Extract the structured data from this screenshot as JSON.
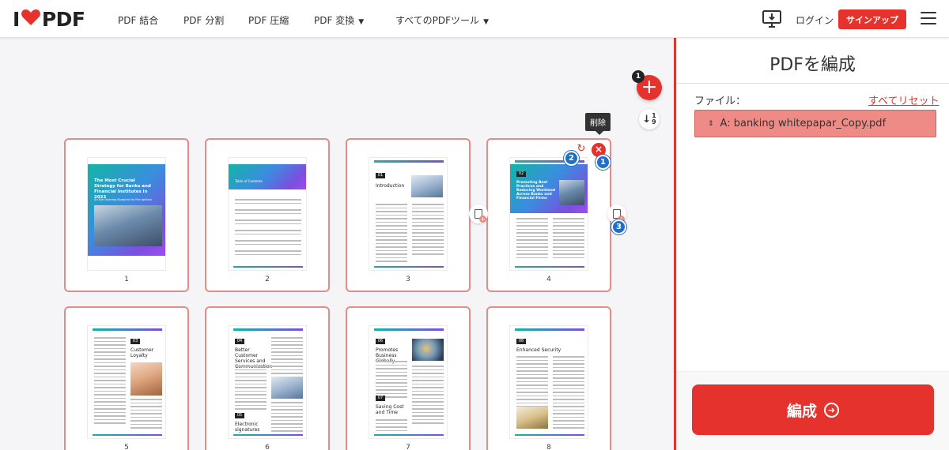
{
  "app": {
    "logo_text_left": "I",
    "logo_text_right": "PDF",
    "colors": {
      "brand_red": "#e5322d",
      "selection_border": "#e88a86",
      "step_blue": "#1f6fc9"
    }
  },
  "header": {
    "nav": [
      {
        "label": "PDF 結合"
      },
      {
        "label": "PDF 分割"
      },
      {
        "label": "PDF 圧縮"
      },
      {
        "label": "PDF 変換",
        "has_dropdown": true
      },
      {
        "label": "すべてのPDFツール",
        "has_dropdown": true
      }
    ],
    "desktop_icon": "desktop-download-icon",
    "login": "ログイン",
    "signup": "サインアップ",
    "menu_icon": "hamburger-menu-icon"
  },
  "workspace": {
    "file_count_badge": "1",
    "sort_label_top": "1",
    "sort_label_bottom": "9",
    "tooltip": "削除",
    "step_badges": [
      "1",
      "2",
      "3"
    ],
    "pages": [
      {
        "number": "1",
        "cover_title": "The Most Crucial Strategy for Banks and Financial Institutes in 2022",
        "cover_sub": "An Eye-Opening Blueprint for Fire Ignition"
      },
      {
        "number": "2",
        "toc_title": "Table of Contents"
      },
      {
        "number": "3",
        "chip": "01",
        "section": "Introduction"
      },
      {
        "number": "4",
        "chip": "02",
        "section": "Promoting Best Practices and Reducing Workload Across Banks and Financial Firms"
      },
      {
        "number": "5",
        "chip": "03",
        "section": "Customer Loyalty"
      },
      {
        "number": "6",
        "chip": "04",
        "section": "Better Customer Services and Communication",
        "chip2": "05",
        "section2": "Electronic signatures"
      },
      {
        "number": "7",
        "chip": "06",
        "section": "Promotes Business Globally",
        "chip2": "07",
        "section2": "Saving Cost and Time"
      },
      {
        "number": "8",
        "chip": "08",
        "section": "Enhanced Security"
      }
    ]
  },
  "sidebar": {
    "title": "PDFを編成",
    "files_label": "ファイル：",
    "reset_all": "すべてリセット",
    "file_name": "A: banking whitepapar_Copy.pdf",
    "organize_button": "編成"
  }
}
